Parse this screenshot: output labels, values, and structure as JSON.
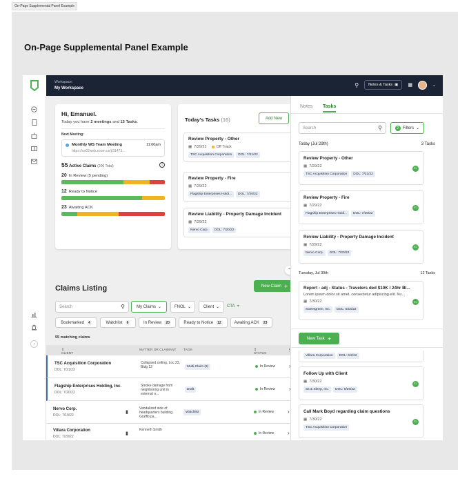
{
  "page_tag": "On-Page Supplemental Panel Example",
  "heading": "On-Page Supplemental Panel Example",
  "topbar": {
    "workspace_label": "Workspace:",
    "workspace_value": "My Workspace",
    "notes_tasks": "Notes & Tasks"
  },
  "greeting": {
    "title": "Hi, Emanuel.",
    "sub_pre": "Today you have ",
    "meetings": "2 meetings",
    "sub_mid": " and ",
    "tasks": "15 Tasks",
    "sub_end": ".",
    "next_label": "Next Meeting:",
    "meeting_title": "Monthly WS Team Meeting",
    "meeting_time": "11:00am",
    "meeting_link": "https://us02web.zoom.us/j/31473...",
    "active_count": "55",
    "active_label": "Active Claims",
    "active_total": "(200 Total)",
    "bars": [
      {
        "count": "20",
        "label": "In Review (5 pending)",
        "g": 0.6,
        "y": 0.25,
        "r": 0.15
      },
      {
        "count": "12",
        "label": "Ready to Notice",
        "g": 0.78,
        "y": 0.22,
        "r": 0
      },
      {
        "count": "23",
        "label": "Awaiting ACK",
        "g": 0.15,
        "y": 0.4,
        "r": 0.45
      }
    ]
  },
  "todays_tasks": {
    "title": "Today's Tasks",
    "count": "(16)",
    "add": "Add New",
    "items": [
      {
        "title": "Review Property - Other",
        "date": "7/29/22",
        "flag": "Off Track",
        "tags": [
          "TSC Acquisition Corporation",
          "DOL: 7/21/22"
        ]
      },
      {
        "title": "Review Property - Fire",
        "date": "7/29/22",
        "flag": "",
        "tags": [
          "Flagship Enterprises Holdi...",
          "DOL: 7/20/22"
        ]
      },
      {
        "title": "Review Liability - Property Damage Incident",
        "date": "7/29/22",
        "flag": "",
        "tags": [
          "Nervo Corp.",
          "DOL: 7/20/22"
        ]
      }
    ]
  },
  "claims": {
    "title": "Claims Listing",
    "new_claim": "New Claim",
    "search_placeholder": "Search",
    "my_claims": "My Claims",
    "fnol": "FNOL",
    "client": "Client",
    "cta": "CTA",
    "quick": [
      {
        "label": "Bookmarked",
        "count": "4"
      },
      {
        "label": "Watchlist",
        "count": "6"
      },
      {
        "label": "In Review",
        "count": "20"
      },
      {
        "label": "Ready to Notice",
        "count": "12"
      },
      {
        "label": "Awaiting ACK",
        "count": "23"
      }
    ],
    "matching": "55 matching claims",
    "headers": {
      "client": "CLIENT",
      "matter": "MATTER OR CLAIMANT",
      "tags": "TAGS",
      "status": "STATUS"
    },
    "rows": [
      {
        "client": "TSC Acquisition Corporation",
        "dol": "DOL: 7/21/22",
        "matter": "Collapsed ceiling, Loc 23, Bldg 12",
        "tag": "Multi-Claim (3)",
        "status": "In Review",
        "bookmark": false
      },
      {
        "client": "Flagship Enterprises Holding, Inc.",
        "dol": "DOL: 7/20/22",
        "matter": "Smoke damage from neighboring unit in external o...",
        "tag": "Draft",
        "status": "In Review",
        "bookmark": false
      },
      {
        "client": "Nervo Corp.",
        "dol": "DOL: 7/19/22",
        "matter": "Vandalized side of headquarters building. Graffiti pa...",
        "tag": "Watchlist",
        "status": "In Review",
        "bookmark": true
      },
      {
        "client": "Villara Corporation",
        "dol": "DOL: 7/20/22",
        "matter": "Kenneth Smith",
        "tag": "",
        "status": "In Review",
        "bookmark": true
      }
    ]
  },
  "panel": {
    "tab_notes": "Notes",
    "tab_tasks": "Tasks",
    "search_placeholder": "Search",
    "filters": "Filters",
    "filters_count": "2",
    "today_label": "Today (Jul 29th)",
    "today_count": "3 Tasks",
    "today_items": [
      {
        "title": "Review Property - Other",
        "date": "7/29/22",
        "tags": [
          "TSC Acquisition Corporation",
          "DOL: 7/21/22"
        ],
        "avatar": "EJ"
      },
      {
        "title": "Review Property - Fire",
        "date": "7/29/22",
        "tags": [
          "Flagship Enterprises Holdi...",
          "DOL: 7/20/22"
        ],
        "avatar": "EJ"
      },
      {
        "title": "Review Liability - Property Damage Incident",
        "date": "7/29/22",
        "tags": [
          "Nervo Corp.",
          "DOL: 7/20/22"
        ],
        "avatar": "EJ"
      }
    ],
    "tue_label": "Tuesday, Jul 30th",
    "tue_count": "12 Tasks",
    "tue_item": {
      "title": "Report - adj - Status - Travelers ded $10K / 24hr Bl...",
      "desc": "Lorem ipsum dolor sit amet, consectetur adipiscing elit. Nu...",
      "date": "7/30/22",
      "tags": [
        "Sweetgreen, Inc.",
        "DOL: 5/15/22"
      ],
      "avatar": "EJ"
    },
    "new_task": "New Task",
    "villara_tags": [
      "Villara Corporation",
      "DOL: 6/2/22"
    ],
    "later_items": [
      {
        "title": "Follow Up with Client",
        "date": "7/30/22",
        "tags": [
          "Sit & Sleep, Inc.",
          "DOL: 6/26/22"
        ],
        "avatar": "EJ"
      },
      {
        "title": "Call Mark Boyd regarding claim questions",
        "date": "7/30/22",
        "tags": [
          "TSC Acquisition Corporation"
        ],
        "avatar": "EJ"
      }
    ]
  }
}
